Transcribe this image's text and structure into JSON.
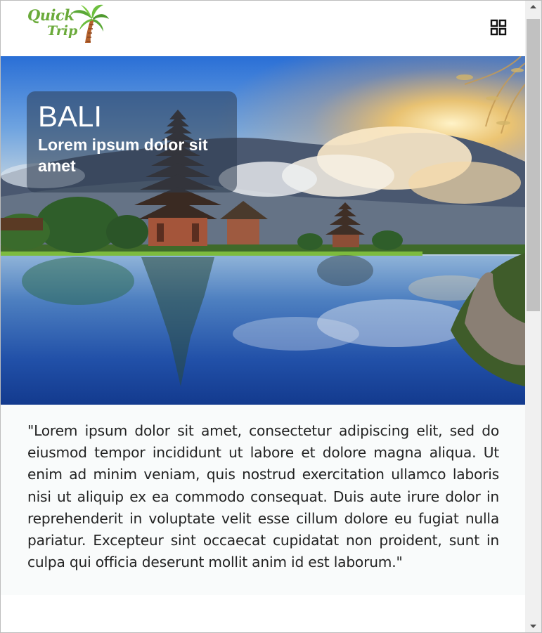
{
  "header": {
    "logo_line1": "Quick",
    "logo_line2": "Trip",
    "menu_icon": "grid-menu-icon"
  },
  "hero": {
    "title": "BALI",
    "subtitle": "Lorem ipsum dolor sit amet"
  },
  "content": {
    "paragraph": "\"Lorem ipsum dolor sit amet, consectetur adipiscing elit, sed do eiusmod tempor incididunt ut labore et dolore magna aliqua. Ut enim ad minim veniam, quis nostrud exercitation ullamco laboris nisi ut aliquip ex ea commodo consequat. Duis aute irure dolor in reprehenderit in voluptate velit esse cillum dolore eu fugiat nulla pariatur. Excepteur sint occaecat cupidatat non proident, sunt in culpa qui officia deserunt mollit anim id est laborum.\""
  },
  "colors": {
    "logo_green": "#6aaa3a",
    "card_overlay": "#2d3c50"
  }
}
